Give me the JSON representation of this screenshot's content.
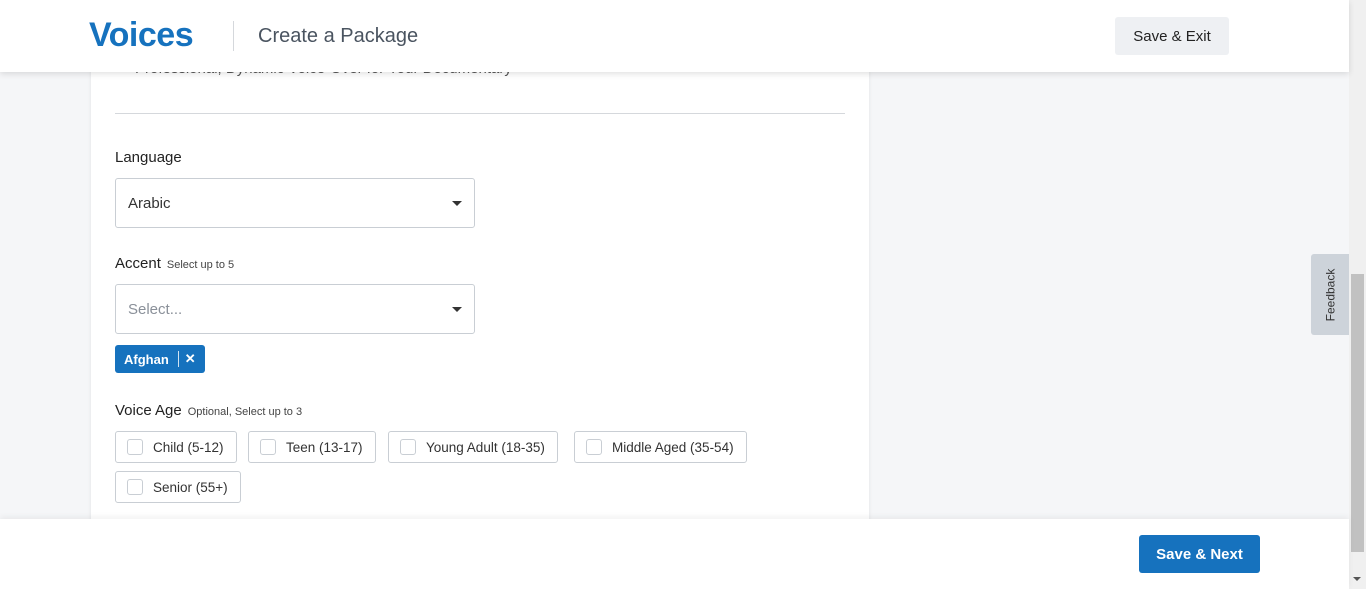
{
  "header": {
    "logo": "Voices",
    "title": "Create a Package",
    "save_exit": "Save & Exit"
  },
  "form": {
    "package_subtitle": "Professional, Dynamic Voice-Over for Your Documentary",
    "language": {
      "label": "Language",
      "value": "Arabic"
    },
    "accent": {
      "label": "Accent",
      "hint": "Select up to 5",
      "placeholder": "Select...",
      "tags": [
        "Afghan"
      ]
    },
    "voice_age": {
      "label": "Voice Age",
      "hint": "Optional, Select up to 3",
      "options": [
        "Child (5-12)",
        "Teen (13-17)",
        "Young Adult (18-35)",
        "Middle Aged (35-54)",
        "Senior (55+)"
      ]
    }
  },
  "feedback": "Feedback",
  "footer": {
    "save_next": "Save & Next"
  }
}
